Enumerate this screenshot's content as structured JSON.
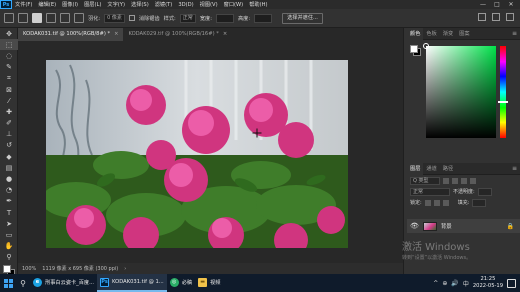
{
  "app": {
    "logo_text": "Ps"
  },
  "menubar": {
    "items": [
      "文件(F)",
      "编辑(E)",
      "图像(I)",
      "图层(L)",
      "文字(Y)",
      "选择(S)",
      "滤镜(T)",
      "3D(D)",
      "视图(V)",
      "窗口(W)",
      "帮助(H)"
    ],
    "controls": {
      "minimize": "—",
      "maximize": "□",
      "close": "✕"
    }
  },
  "optionsbar": {
    "feather_label": "羽化:",
    "feather_value": "0 像素",
    "antialias_label": "消除锯齿",
    "style_label": "样式:",
    "style_value": "正常",
    "width_label": "宽度:",
    "height_label": "高度:",
    "select_mask_label": "选择并遮住..."
  },
  "tabs": [
    {
      "label": "KODAK031.tif @ 100%(RGB/8#) *",
      "close": "×",
      "active": true
    },
    {
      "label": "KODAK029.tif @ 100%(RGB/16#) *",
      "close": "×",
      "active": false
    }
  ],
  "statusbar": {
    "zoom": "100%",
    "dimensions": "1119 像素 x 695 像素 (300 ppi)",
    "arrow": "›"
  },
  "color_panel": {
    "tabs": [
      "颜色",
      "色板",
      "渐变",
      "图案"
    ],
    "colors": {
      "foreground": "#ffffff",
      "background": "#000000",
      "field_hue": "#00e24a"
    }
  },
  "layers_panel": {
    "tabs": [
      "图层",
      "通道",
      "路径"
    ],
    "kind_filter": "Q 类型",
    "blend_mode": "正常",
    "opacity_label": "不透明度:",
    "lock_label": "锁定:",
    "fill_label": "填充:",
    "layer": {
      "name": "背景",
      "eye": "👁",
      "lock": "🔒"
    },
    "footer_icons": [
      "ƒx",
      "◐",
      "▭",
      "＋",
      "🗑"
    ]
  },
  "watermark": {
    "title": "激活 Windows",
    "subtitle": "转到“设置”以激活 Windows。"
  },
  "taskbar": {
    "apps": [
      {
        "icon": "edge",
        "label": "刑事白云姿卡_百度..."
      },
      {
        "icon": "ps",
        "label": "KODAK031.tif @ 1..."
      },
      {
        "icon": "wechat",
        "label": "必稿"
      },
      {
        "icon": "folder",
        "label": "视频"
      }
    ],
    "tray": {
      "chevron": "^",
      "network": "⊕",
      "volume": "🔊",
      "ime": "中"
    },
    "time": "21:25",
    "date": "2022-05-19"
  }
}
